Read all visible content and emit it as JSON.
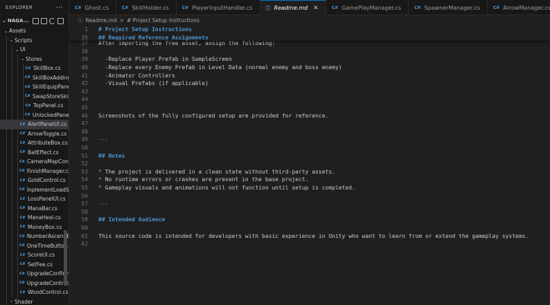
{
  "explorer": {
    "title": "EXPLORER",
    "more": "···",
    "project": "NAGA...",
    "tree": [
      {
        "label": "Assets",
        "kind": "folder",
        "depth": 0,
        "open": true
      },
      {
        "label": "Scripts",
        "kind": "folder",
        "depth": 1,
        "open": true
      },
      {
        "label": "UI",
        "kind": "folder",
        "depth": 2,
        "open": true
      },
      {
        "label": "Stores",
        "kind": "folder",
        "depth": 3,
        "open": true
      },
      {
        "label": "SkillBox.cs",
        "kind": "cs",
        "depth": 4
      },
      {
        "label": "SkillBoxAdding.cs",
        "kind": "cs",
        "depth": 4
      },
      {
        "label": "SkillEquipPanel.cs",
        "kind": "cs",
        "depth": 4
      },
      {
        "label": "SwapStoreSkill.cs",
        "kind": "cs",
        "depth": 4
      },
      {
        "label": "TopPanel.cs",
        "kind": "cs",
        "depth": 4
      },
      {
        "label": "UnlockedPanel.cs",
        "kind": "cs",
        "depth": 4
      },
      {
        "label": "AlertPanelUI.cs",
        "kind": "cs",
        "depth": 3,
        "selected": true
      },
      {
        "label": "ArrowToggle.cs",
        "kind": "cs",
        "depth": 3
      },
      {
        "label": "AttributeBox.cs",
        "kind": "cs",
        "depth": 3
      },
      {
        "label": "BatEffect.cs",
        "kind": "cs",
        "depth": 3
      },
      {
        "label": "CameraMapContr...",
        "kind": "cs",
        "depth": 3
      },
      {
        "label": "FinishManager.cs",
        "kind": "cs",
        "depth": 3
      },
      {
        "label": "GoldControl.cs",
        "kind": "cs",
        "depth": 3
      },
      {
        "label": "InplementLoadSc...",
        "kind": "cs",
        "depth": 3
      },
      {
        "label": "LossPanelUI.cs",
        "kind": "cs",
        "depth": 3
      },
      {
        "label": "ManaBar.cs",
        "kind": "cs",
        "depth": 3
      },
      {
        "label": "ManaHeal.cs",
        "kind": "cs",
        "depth": 3
      },
      {
        "label": "MoneyBox.cs",
        "kind": "cs",
        "depth": 3
      },
      {
        "label": "NumberAscendEff...",
        "kind": "cs",
        "depth": 3
      },
      {
        "label": "OneTimeButton.cs",
        "kind": "cs",
        "depth": 3
      },
      {
        "label": "ScoreUI.cs",
        "kind": "cs",
        "depth": 3
      },
      {
        "label": "SetFee.cs",
        "kind": "cs",
        "depth": 3
      },
      {
        "label": "UpgradeConfirmU...",
        "kind": "cs",
        "depth": 3
      },
      {
        "label": "UpgradeControls.cs",
        "kind": "cs",
        "depth": 3
      },
      {
        "label": "WoodControl.cs",
        "kind": "cs",
        "depth": 3
      },
      {
        "label": "Shader",
        "kind": "folder",
        "depth": 1,
        "open": false
      }
    ]
  },
  "tabs": [
    {
      "label": "Ghost.cs",
      "icon": "C#",
      "active": false
    },
    {
      "label": "SkillHolder.cs",
      "icon": "C#",
      "active": false
    },
    {
      "label": "PlayerInputHandler.cs",
      "icon": "C#",
      "active": false
    },
    {
      "label": "Readme.md",
      "icon": "ⓘ",
      "active": true,
      "close": "✕"
    },
    {
      "label": "GamePlayManager.cs",
      "icon": "C#",
      "active": false
    },
    {
      "label": "SpawnerManager.cs",
      "icon": "C#",
      "active": false
    },
    {
      "label": "ArrowManager.cs",
      "icon": "C#",
      "active": false
    }
  ],
  "breadcrumb": {
    "icon": "ⓘ",
    "file": "Readme.md",
    "separator": ">",
    "hash": "#",
    "section": "# Project Setup Instructions"
  },
  "sticky": [
    {
      "n": "1",
      "text": "# Project Setup Instructions",
      "style": "heading"
    },
    {
      "n": "35",
      "text": "## Required Reference Assignments",
      "style": "heading"
    }
  ],
  "lines": [
    {
      "n": "37",
      "text": "After importing the free asset, assign the following:",
      "style": ""
    },
    {
      "n": "38",
      "text": "",
      "style": ""
    },
    {
      "n": "39",
      "text": "  -Replace Player Prefab in SampleScreen",
      "style": ""
    },
    {
      "n": "40",
      "text": "  -Replace every Enemy Prefab in Level Data (normal enemy and boss enemy)",
      "style": ""
    },
    {
      "n": "41",
      "text": "  -Animator Controllers",
      "style": ""
    },
    {
      "n": "42",
      "text": "  -Visual Prefabs (if applicable)",
      "style": ""
    },
    {
      "n": "43",
      "text": "",
      "style": ""
    },
    {
      "n": "44",
      "text": "",
      "style": ""
    },
    {
      "n": "45",
      "text": "",
      "style": ""
    },
    {
      "n": "46",
      "text": "Screenshots of the fully configured setup are provided for reference.",
      "style": ""
    },
    {
      "n": "47",
      "text": "",
      "style": ""
    },
    {
      "n": "48",
      "text": "",
      "style": ""
    },
    {
      "n": "49",
      "text": "---",
      "style": "dim"
    },
    {
      "n": "50",
      "text": "",
      "style": ""
    },
    {
      "n": "51",
      "text": "## Notes",
      "style": "heading"
    },
    {
      "n": "52",
      "text": "",
      "style": ""
    },
    {
      "n": "53",
      "text": "* The project is delivered in a clean state without third-party assets.",
      "style": "bullet"
    },
    {
      "n": "54",
      "text": "* No runtime errors or crashes are present in the base project.",
      "style": "bullet"
    },
    {
      "n": "55",
      "text": "* Gameplay visuals and animations will not function until setup is completed.",
      "style": "bullet"
    },
    {
      "n": "56",
      "text": "",
      "style": ""
    },
    {
      "n": "57",
      "text": "---",
      "style": "dim"
    },
    {
      "n": "58",
      "text": "",
      "style": ""
    },
    {
      "n": "59",
      "text": "## Intended Audience",
      "style": "heading"
    },
    {
      "n": "60",
      "text": "",
      "style": ""
    },
    {
      "n": "61",
      "text": "This source code is intended for developers with basic experience in Unity who want to learn from or extend the gameplay systems.",
      "style": ""
    },
    {
      "n": "62",
      "text": "",
      "style": ""
    }
  ],
  "colors": {
    "accent": "#0078d4",
    "heading": "#4e94ce",
    "csicon": "#4aa0e6"
  }
}
